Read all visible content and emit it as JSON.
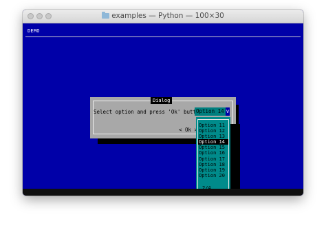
{
  "window": {
    "title": "examples — Python — 100×30"
  },
  "screen": {
    "label": "DEMO"
  },
  "dialog": {
    "title": "Dialog",
    "prompt": "Select option and press 'Ok' button:",
    "selected_value": "Option 14",
    "arrow_glyph": "v",
    "ok_label": "< Ok >"
  },
  "dropdown": {
    "options": [
      "Option 11",
      "Option 12",
      "Option 13",
      "Option 14",
      "Option 15",
      "Option 16",
      "Option 17",
      "Option 18",
      "Option 19",
      "Option 20"
    ],
    "selected_index": 3,
    "pager": "2/4"
  },
  "colors": {
    "terminal_background": "#0000a8",
    "dialog_background": "#a8a8a8",
    "dropdown_background": "#008b8b",
    "selected_background": "#000000"
  },
  "icons": {
    "window_icon": "folder-icon"
  }
}
